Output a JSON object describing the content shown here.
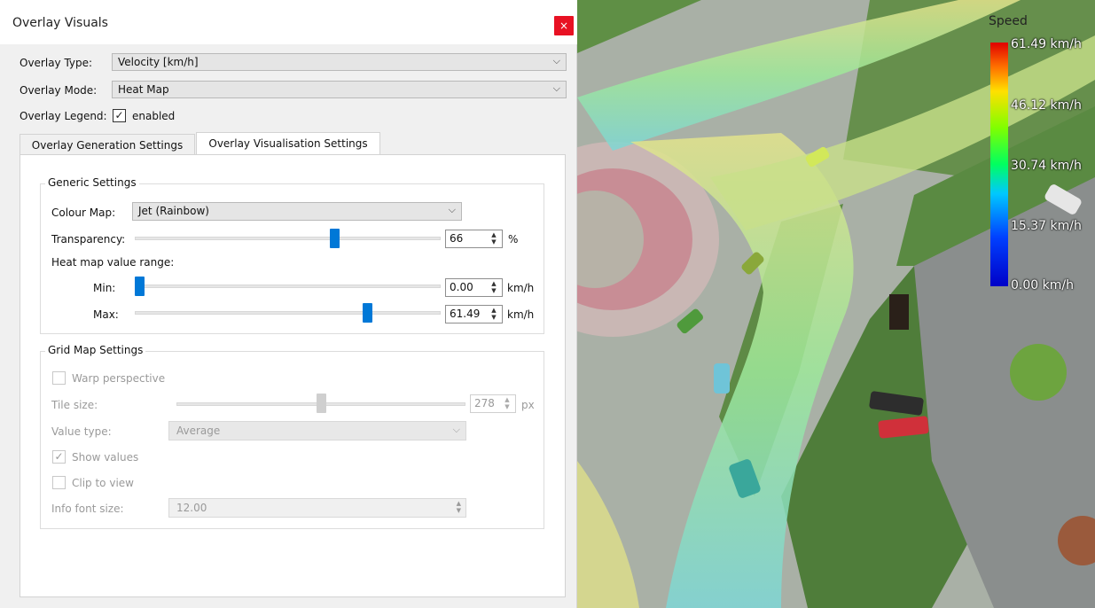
{
  "dialog": {
    "title": "Overlay Visuals",
    "close_glyph": "×"
  },
  "overlay": {
    "type_label": "Overlay Type:",
    "type_value": "Velocity [km/h]",
    "mode_label": "Overlay Mode:",
    "mode_value": "Heat Map",
    "legend_label": "Overlay Legend:",
    "legend_checked_glyph": "✓",
    "legend_value": "enabled"
  },
  "tabs": [
    {
      "label": "Overlay Generation Settings",
      "active": false
    },
    {
      "label": "Overlay Visualisation Settings",
      "active": true
    }
  ],
  "generic": {
    "title": "Generic Settings",
    "colour_map_label": "Colour Map:",
    "colour_map_value": "Jet (Rainbow)",
    "transparency_label": "Transparency:",
    "transparency_value": "66",
    "transparency_unit": "%",
    "transparency_level": 0.66,
    "range_label": "Heat map value range:",
    "min_label": "Min:",
    "min_value": "0.00",
    "min_unit": "km/h",
    "min_level": 0.0,
    "max_label": "Max:",
    "max_value": "61.49",
    "max_unit": "km/h",
    "max_level": 0.77
  },
  "grid": {
    "title": "Grid Map Settings",
    "warp_label": "Warp perspective",
    "tile_label": "Tile size:",
    "tile_value": "278",
    "tile_unit": "px",
    "tile_level": 0.5,
    "value_type_label": "Value type:",
    "value_type_value": "Average",
    "show_values_label": "Show values",
    "show_values_glyph": "✓",
    "clip_label": "Clip to view",
    "font_label": "Info font size:",
    "font_value": "12.00"
  },
  "legend": {
    "title": "Speed",
    "labels": [
      "61.49 km/h",
      "46.12 km/h",
      "30.74 km/h",
      "15.37 km/h",
      "0.00 km/h"
    ]
  },
  "icons": {
    "chevron": "⌵",
    "spin_up": "▲",
    "spin_down": "▼"
  }
}
